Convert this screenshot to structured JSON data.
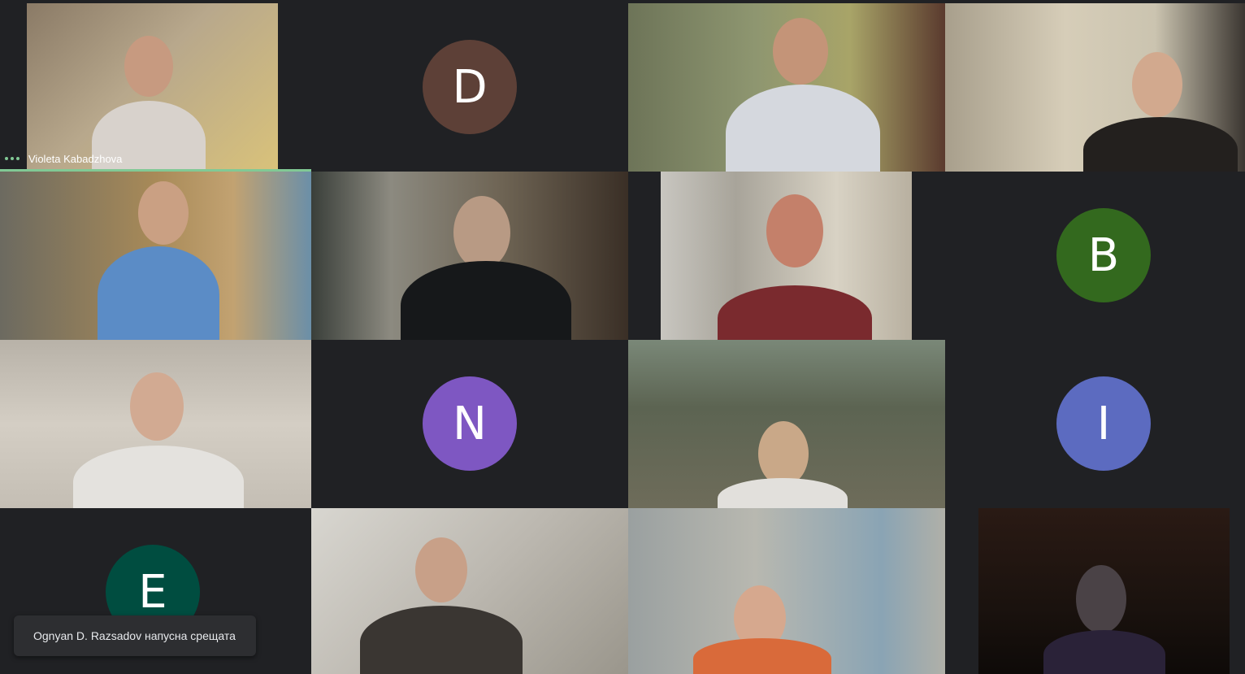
{
  "colors": {
    "background": "#202124",
    "speaking_indicator": "#81c995",
    "avatar_d": "#5d4037",
    "avatar_b": "#33691e",
    "avatar_n": "#7e57c2",
    "avatar_i": "#5c6bc0",
    "avatar_e": "#004d40"
  },
  "tiles": [
    {
      "kind": "video",
      "name_label": "Violeta Kabadzhova",
      "speaking": true
    },
    {
      "kind": "avatar",
      "initial": "D"
    },
    {
      "kind": "video"
    },
    {
      "kind": "video"
    },
    {
      "kind": "video"
    },
    {
      "kind": "video"
    },
    {
      "kind": "video"
    },
    {
      "kind": "avatar",
      "initial": "B"
    },
    {
      "kind": "video"
    },
    {
      "kind": "avatar",
      "initial": "N"
    },
    {
      "kind": "video"
    },
    {
      "kind": "avatar",
      "initial": "I"
    },
    {
      "kind": "avatar",
      "initial": "E"
    },
    {
      "kind": "video"
    },
    {
      "kind": "video"
    },
    {
      "kind": "video"
    }
  ],
  "toast": {
    "message": "Ognyan D. Razsadov напусна срещата"
  },
  "icons": {
    "speaking_indicator": "three-dots-icon"
  }
}
